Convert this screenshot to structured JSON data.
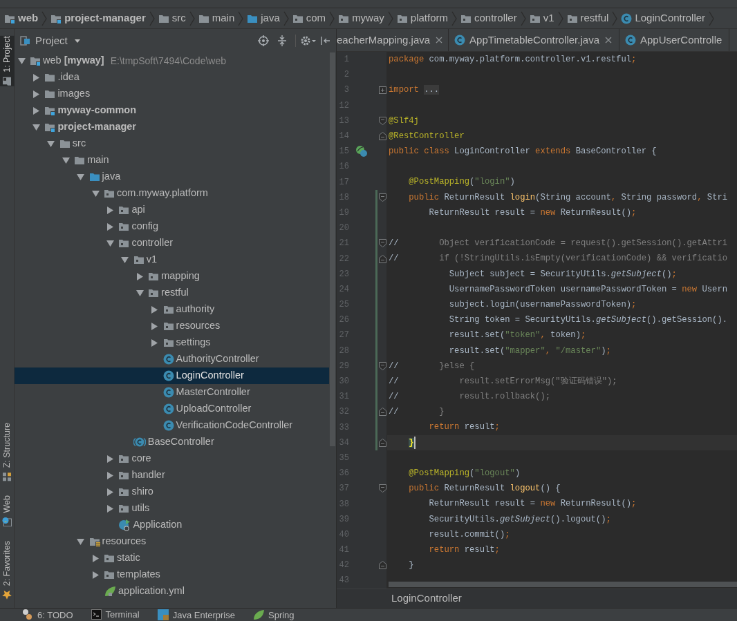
{
  "breadcrumbs": [
    {
      "label": "web",
      "kind": "module"
    },
    {
      "label": "project-manager",
      "kind": "module"
    },
    {
      "label": "src",
      "kind": "folder"
    },
    {
      "label": "main",
      "kind": "folder"
    },
    {
      "label": "java",
      "kind": "source"
    },
    {
      "label": "com",
      "kind": "package"
    },
    {
      "label": "myway",
      "kind": "package"
    },
    {
      "label": "platform",
      "kind": "package"
    },
    {
      "label": "controller",
      "kind": "package"
    },
    {
      "label": "v1",
      "kind": "package"
    },
    {
      "label": "restful",
      "kind": "package"
    },
    {
      "label": "LoginController",
      "kind": "class"
    }
  ],
  "tool_strip": [
    {
      "label": "1: Project",
      "kind": "project",
      "selected": true
    },
    {
      "label": "Z: Structure",
      "kind": "structure",
      "selected": false
    },
    {
      "label": "Web",
      "kind": "web",
      "selected": false
    },
    {
      "label": "2: Favorites",
      "kind": "favorites",
      "selected": false
    }
  ],
  "project_panel": {
    "title": "Project",
    "tree": [
      {
        "label": "web **[myway]**",
        "path": "E:\\tmpSoft\\7494\\Code\\web",
        "kind": "project",
        "expanded": true,
        "selected": false,
        "children": [
          {
            "label": ".idea",
            "kind": "folder",
            "expanded": false,
            "selected": false
          },
          {
            "label": "images",
            "kind": "folder",
            "expanded": false,
            "selected": false
          },
          {
            "label": "myway-common",
            "kind": "module",
            "expanded": false,
            "selected": false
          },
          {
            "label": "project-manager",
            "kind": "module",
            "expanded": true,
            "selected": false,
            "children": [
              {
                "label": "src",
                "kind": "folder",
                "expanded": true,
                "selected": false,
                "children": [
                  {
                    "label": "main",
                    "kind": "folder",
                    "expanded": true,
                    "selected": false,
                    "children": [
                      {
                        "label": "java",
                        "kind": "source",
                        "expanded": true,
                        "selected": false,
                        "children": [
                          {
                            "label": "com.myway.platform",
                            "kind": "package",
                            "expanded": true,
                            "selected": false,
                            "children": [
                              {
                                "label": "api",
                                "kind": "package",
                                "expanded": false,
                                "selected": false
                              },
                              {
                                "label": "config",
                                "kind": "package",
                                "expanded": false,
                                "selected": false
                              },
                              {
                                "label": "controller",
                                "kind": "package",
                                "expanded": true,
                                "selected": false,
                                "children": [
                                  {
                                    "label": "v1",
                                    "kind": "package",
                                    "expanded": true,
                                    "selected": false,
                                    "children": [
                                      {
                                        "label": "mapping",
                                        "kind": "package",
                                        "expanded": false,
                                        "selected": false
                                      },
                                      {
                                        "label": "restful",
                                        "kind": "package",
                                        "expanded": true,
                                        "selected": false,
                                        "children": [
                                          {
                                            "label": "authority",
                                            "kind": "package",
                                            "expanded": false,
                                            "selected": false
                                          },
                                          {
                                            "label": "resources",
                                            "kind": "package",
                                            "expanded": false,
                                            "selected": false
                                          },
                                          {
                                            "label": "settings",
                                            "kind": "package",
                                            "expanded": false,
                                            "selected": false
                                          },
                                          {
                                            "label": "AuthorityController",
                                            "kind": "class",
                                            "selected": false
                                          },
                                          {
                                            "label": "LoginController",
                                            "kind": "class",
                                            "selected": true
                                          },
                                          {
                                            "label": "MasterController",
                                            "kind": "class",
                                            "selected": false
                                          },
                                          {
                                            "label": "UploadController",
                                            "kind": "class",
                                            "selected": false
                                          },
                                          {
                                            "label": "VerificationCodeController",
                                            "kind": "class",
                                            "selected": false
                                          }
                                        ]
                                      }
                                    ]
                                  },
                                  {
                                    "label": "BaseController",
                                    "kind": "abstract",
                                    "selected": false
                                  }
                                ]
                              },
                              {
                                "label": "core",
                                "kind": "package",
                                "expanded": false,
                                "selected": false
                              },
                              {
                                "label": "handler",
                                "kind": "package",
                                "expanded": false,
                                "selected": false
                              },
                              {
                                "label": "shiro",
                                "kind": "package",
                                "expanded": false,
                                "selected": false
                              },
                              {
                                "label": "utils",
                                "kind": "package",
                                "expanded": false,
                                "selected": false
                              },
                              {
                                "label": "Application",
                                "kind": "app",
                                "selected": false
                              }
                            ]
                          }
                        ]
                      },
                      {
                        "label": "resources",
                        "kind": "resources",
                        "expanded": true,
                        "selected": false,
                        "children": [
                          {
                            "label": "static",
                            "kind": "package",
                            "expanded": false,
                            "selected": false
                          },
                          {
                            "label": "templates",
                            "kind": "package",
                            "expanded": false,
                            "selected": false
                          },
                          {
                            "label": "application.yml",
                            "kind": "yaml",
                            "selected": false
                          }
                        ]
                      }
                    ]
                  }
                ]
              }
            ]
          }
        ]
      }
    ]
  },
  "editor": {
    "tabs": [
      {
        "label": "eacherMapping.java",
        "kind": "plain",
        "closable": true
      },
      {
        "label": "AppTimetableController.java",
        "kind": "class",
        "closable": true
      },
      {
        "label": "AppUserControlle",
        "kind": "class",
        "closable": false
      }
    ],
    "lines": [
      {
        "number": "1",
        "current": false,
        "changed": false,
        "tokens": [
          {
            "kind": "kw",
            "text": "package"
          },
          {
            "kind": "plain",
            "text": " com.myway.platform.controller.v1.restful"
          },
          {
            "kind": "kw",
            "text": ";"
          }
        ]
      },
      {
        "number": "2",
        "current": false,
        "changed": false
      },
      {
        "number": "3",
        "current": false,
        "changed": false,
        "folded": true,
        "tokens": [
          {
            "kind": "kw",
            "text": "import "
          },
          {
            "kind": "folded",
            "text": "..."
          }
        ]
      },
      {
        "number": "12",
        "current": false,
        "changed": false
      },
      {
        "number": "13",
        "current": false,
        "changed": false,
        "fold_start": true,
        "tokens": [
          {
            "kind": "ann",
            "text": "@Slf4j"
          }
        ]
      },
      {
        "number": "14",
        "current": false,
        "changed": false,
        "fold_end": true,
        "tokens": [
          {
            "kind": "ann",
            "text": "@RestController"
          }
        ]
      },
      {
        "number": "15",
        "current": false,
        "changed": false,
        "gutter_icon": true,
        "tokens": [
          {
            "kind": "kw",
            "text": "public class "
          },
          {
            "kind": "plain",
            "text": "LoginController "
          },
          {
            "kind": "kw",
            "text": "extends "
          },
          {
            "kind": "plain",
            "text": "BaseController {"
          }
        ]
      },
      {
        "number": "16",
        "current": false,
        "changed": false
      },
      {
        "number": "17",
        "current": false,
        "changed": false,
        "tokens": [
          {
            "kind": "ann",
            "text": "    @PostMapping"
          },
          {
            "kind": "plain",
            "text": "("
          },
          {
            "kind": "str",
            "text": "\"login\""
          },
          {
            "kind": "plain",
            "text": ")"
          }
        ]
      },
      {
        "number": "18",
        "current": false,
        "changed": true,
        "fold_start": true,
        "tokens": [
          {
            "kind": "kw",
            "text": "    public "
          },
          {
            "kind": "plain",
            "text": "ReturnResult "
          },
          {
            "kind": "fn",
            "text": "login"
          },
          {
            "kind": "plain",
            "text": "(String account"
          },
          {
            "kind": "kw",
            "text": ","
          },
          {
            "kind": "plain",
            "text": " String password"
          },
          {
            "kind": "kw",
            "text": ","
          },
          {
            "kind": "plain",
            "text": " Stri"
          }
        ]
      },
      {
        "number": "19",
        "current": false,
        "changed": true,
        "tokens": [
          {
            "kind": "plain",
            "text": "        ReturnResult result = "
          },
          {
            "kind": "kw",
            "text": "new "
          },
          {
            "kind": "plain",
            "text": "ReturnResult()"
          },
          {
            "kind": "kw",
            "text": ";"
          }
        ]
      },
      {
        "number": "20",
        "current": false,
        "changed": true
      },
      {
        "number": "21",
        "current": false,
        "changed": true,
        "fold_start": true,
        "tokens": [
          {
            "kind": "plain",
            "text": "//"
          },
          {
            "kind": "cmt",
            "text": "        Object verificationCode = request().getSession().getAttri"
          }
        ]
      },
      {
        "number": "22",
        "current": false,
        "changed": true,
        "fold_end": true,
        "tokens": [
          {
            "kind": "plain",
            "text": "//"
          },
          {
            "kind": "cmt",
            "text": "        if (!StringUtils.isEmpty(verificationCode) && verificatio"
          }
        ]
      },
      {
        "number": "23",
        "current": false,
        "changed": true,
        "tokens": [
          {
            "kind": "plain",
            "text": "            Subject subject = SecurityUtils."
          },
          {
            "kind": "ital",
            "text": "getSubject"
          },
          {
            "kind": "plain",
            "text": "()"
          },
          {
            "kind": "kw",
            "text": ";"
          }
        ]
      },
      {
        "number": "24",
        "current": false,
        "changed": true,
        "tokens": [
          {
            "kind": "plain",
            "text": "            UsernamePasswordToken usernamePasswordToken = "
          },
          {
            "kind": "kw",
            "text": "new "
          },
          {
            "kind": "plain",
            "text": "Usern"
          }
        ]
      },
      {
        "number": "25",
        "current": false,
        "changed": true,
        "tokens": [
          {
            "kind": "plain",
            "text": "            subject.login(usernamePasswordToken)"
          },
          {
            "kind": "kw",
            "text": ";"
          }
        ]
      },
      {
        "number": "26",
        "current": false,
        "changed": true,
        "tokens": [
          {
            "kind": "plain",
            "text": "            String token = SecurityUtils."
          },
          {
            "kind": "ital",
            "text": "getSubject"
          },
          {
            "kind": "plain",
            "text": "().getSession()."
          }
        ]
      },
      {
        "number": "27",
        "current": false,
        "changed": true,
        "tokens": [
          {
            "kind": "plain",
            "text": "            result.set("
          },
          {
            "kind": "str",
            "text": "\"token\""
          },
          {
            "kind": "kw",
            "text": ","
          },
          {
            "kind": "plain",
            "text": " token)"
          },
          {
            "kind": "kw",
            "text": ";"
          }
        ]
      },
      {
        "number": "28",
        "current": false,
        "changed": true,
        "tokens": [
          {
            "kind": "plain",
            "text": "            result.set("
          },
          {
            "kind": "str",
            "text": "\"mapper\""
          },
          {
            "kind": "kw",
            "text": ", "
          },
          {
            "kind": "str",
            "text": "\"/master\""
          },
          {
            "kind": "plain",
            "text": ")"
          },
          {
            "kind": "kw",
            "text": ";"
          }
        ]
      },
      {
        "number": "29",
        "current": false,
        "changed": true,
        "fold_start": true,
        "tokens": [
          {
            "kind": "plain",
            "text": "//"
          },
          {
            "kind": "cmt",
            "text": "        }else {"
          }
        ]
      },
      {
        "number": "30",
        "current": false,
        "changed": true,
        "tokens": [
          {
            "kind": "plain",
            "text": "//"
          },
          {
            "kind": "cmt",
            "text": "            result.setErrorMsg(\"验证码错误\");"
          }
        ]
      },
      {
        "number": "31",
        "current": false,
        "changed": true,
        "tokens": [
          {
            "kind": "plain",
            "text": "//"
          },
          {
            "kind": "cmt",
            "text": "            result.rollback();"
          }
        ]
      },
      {
        "number": "32",
        "current": false,
        "changed": true,
        "fold_end": true,
        "tokens": [
          {
            "kind": "plain",
            "text": "//"
          },
          {
            "kind": "cmt",
            "text": "        }"
          }
        ]
      },
      {
        "number": "33",
        "current": false,
        "changed": true,
        "tokens": [
          {
            "kind": "kw",
            "text": "        return "
          },
          {
            "kind": "plain",
            "text": "result"
          },
          {
            "kind": "kw",
            "text": ";"
          }
        ]
      },
      {
        "number": "34",
        "current": true,
        "changed": true,
        "caret": true,
        "fold_end": true,
        "tokens": [
          {
            "kind": "match",
            "text": "    }"
          }
        ]
      },
      {
        "number": "35",
        "current": false,
        "changed": false
      },
      {
        "number": "36",
        "current": false,
        "changed": false,
        "tokens": [
          {
            "kind": "ann",
            "text": "    @PostMapping"
          },
          {
            "kind": "plain",
            "text": "("
          },
          {
            "kind": "str",
            "text": "\"logout\""
          },
          {
            "kind": "plain",
            "text": ")"
          }
        ]
      },
      {
        "number": "37",
        "current": false,
        "changed": false,
        "fold_start": true,
        "tokens": [
          {
            "kind": "kw",
            "text": "    public "
          },
          {
            "kind": "plain",
            "text": "ReturnResult "
          },
          {
            "kind": "fn",
            "text": "logout"
          },
          {
            "kind": "plain",
            "text": "() {"
          }
        ]
      },
      {
        "number": "38",
        "current": false,
        "changed": false,
        "tokens": [
          {
            "kind": "plain",
            "text": "        ReturnResult result = "
          },
          {
            "kind": "kw",
            "text": "new "
          },
          {
            "kind": "plain",
            "text": "ReturnResult()"
          },
          {
            "kind": "kw",
            "text": ";"
          }
        ]
      },
      {
        "number": "39",
        "current": false,
        "changed": false,
        "tokens": [
          {
            "kind": "plain",
            "text": "        SecurityUtils."
          },
          {
            "kind": "ital",
            "text": "getSubject"
          },
          {
            "kind": "plain",
            "text": "().logout()"
          },
          {
            "kind": "kw",
            "text": ";"
          }
        ]
      },
      {
        "number": "40",
        "current": false,
        "changed": false,
        "tokens": [
          {
            "kind": "plain",
            "text": "        result.commit()"
          },
          {
            "kind": "kw",
            "text": ";"
          }
        ]
      },
      {
        "number": "41",
        "current": false,
        "changed": false,
        "tokens": [
          {
            "kind": "kw",
            "text": "        return "
          },
          {
            "kind": "plain",
            "text": "result"
          },
          {
            "kind": "kw",
            "text": ";"
          }
        ]
      },
      {
        "number": "42",
        "current": false,
        "changed": false,
        "fold_end": true,
        "tokens": [
          {
            "kind": "plain",
            "text": "    }"
          }
        ]
      },
      {
        "number": "43",
        "current": false,
        "changed": false
      }
    ],
    "footer_breadcrumb": "LoginController"
  },
  "bottom_tools": [
    {
      "label": "6: TODO",
      "kind": "todo"
    },
    {
      "label": "Terminal",
      "kind": "terminal"
    },
    {
      "label": "Java Enterprise",
      "kind": "enterprise"
    },
    {
      "label": "Spring",
      "kind": "spring"
    }
  ]
}
